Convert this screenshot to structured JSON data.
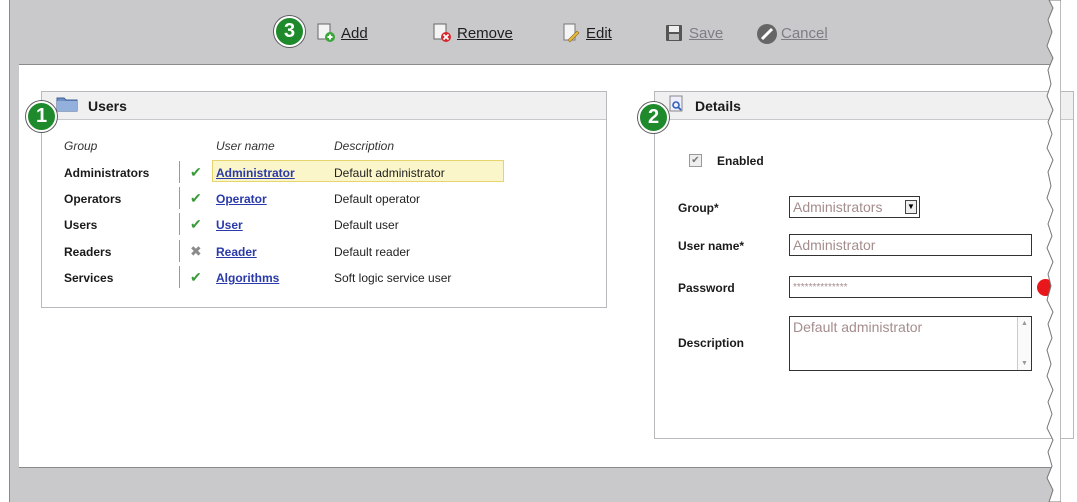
{
  "toolbar": {
    "add_label": "Add",
    "remove_label": "Remove",
    "edit_label": "Edit",
    "save_label": "Save",
    "cancel_label": "Cancel"
  },
  "badges": {
    "users_panel": "1",
    "details_panel": "2",
    "toolbar": "3"
  },
  "users": {
    "title": "Users",
    "columns": {
      "group": "Group",
      "username": "User name",
      "description": "Description"
    },
    "rows": [
      {
        "group": "Administrators",
        "status": "enabled",
        "status_glyph": "✔",
        "username": "Administrator",
        "description": "Default administrator",
        "selected": true
      },
      {
        "group": "Operators",
        "status": "enabled",
        "status_glyph": "✔",
        "username": "Operator",
        "description": "Default operator",
        "selected": false
      },
      {
        "group": "Users",
        "status": "enabled",
        "status_glyph": "✔",
        "username": "User",
        "description": "Default user",
        "selected": false
      },
      {
        "group": "Readers",
        "status": "disabled",
        "status_glyph": "✖",
        "username": "Reader",
        "description": "Default reader",
        "selected": false
      },
      {
        "group": "Services",
        "status": "enabled",
        "status_glyph": "✔",
        "username": "Algorithms",
        "description": "Soft logic service user",
        "selected": false
      }
    ]
  },
  "details": {
    "title": "Details",
    "enabled_label": "Enabled",
    "enabled_checked": true,
    "group_label": "Group*",
    "group_value": "Administrators",
    "username_label": "User name*",
    "username_value": "Administrator",
    "password_label": "Password",
    "password_value": "**************",
    "description_label": "Description",
    "description_value": "Default administrator"
  },
  "colors": {
    "badge_green": "#1f8a2c",
    "link_blue": "#2a3aa8",
    "check_green": "#3b9a3b",
    "required_red": "#e8171b",
    "selection_yellow": "#fbf6c9",
    "frame_gray": "#c9c9cc"
  },
  "icons": {
    "add": "add-user-icon",
    "remove": "remove-user-icon",
    "edit": "edit-icon",
    "save": "floppy-disk-icon",
    "cancel": "cancel-icon",
    "users_panel": "folder-icon",
    "details_panel": "magnifier-icon"
  }
}
